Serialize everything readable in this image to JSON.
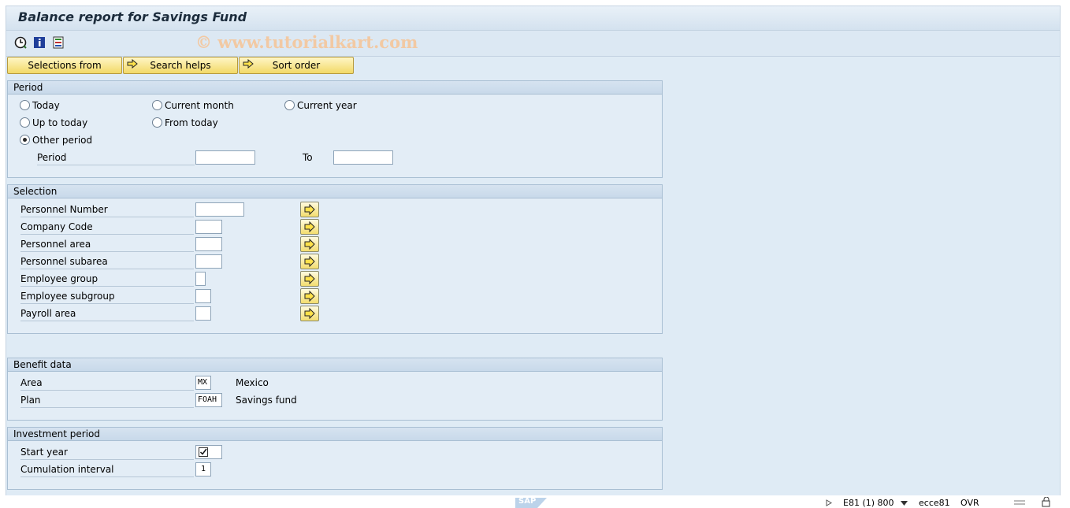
{
  "window": {
    "title": "Balance report for Savings Fund"
  },
  "watermark": "© www.tutorialkart.com",
  "toolbar": {
    "icons": [
      "execute-icon",
      "info-icon",
      "variants-icon"
    ]
  },
  "buttons": {
    "selections_from": "Selections from",
    "search_helps": "Search helps",
    "sort_order": "Sort order"
  },
  "period": {
    "title": "Period",
    "options": {
      "today": "Today",
      "current_month": "Current month",
      "current_year": "Current year",
      "up_to_today": "Up to today",
      "from_today": "From today",
      "other_period": "Other period"
    },
    "selected": "other_period",
    "period_label": "Period",
    "from_value": "",
    "to_label": "To",
    "to_value": ""
  },
  "selection": {
    "title": "Selection",
    "fields": [
      {
        "label": "Personnel Number",
        "value": ""
      },
      {
        "label": "Company Code",
        "value": ""
      },
      {
        "label": "Personnel area",
        "value": ""
      },
      {
        "label": "Personnel subarea",
        "value": ""
      },
      {
        "label": "Employee group",
        "value": ""
      },
      {
        "label": "Employee subgroup",
        "value": ""
      },
      {
        "label": "Payroll area",
        "value": ""
      }
    ]
  },
  "benefit": {
    "title": "Benefit data",
    "area_label": "Area",
    "area_value": "MX",
    "area_desc": "Mexico",
    "plan_label": "Plan",
    "plan_value": "FOAH",
    "plan_desc": "Savings fund"
  },
  "investment": {
    "title": "Investment period",
    "start_year_label": "Start year",
    "start_year_checked": true,
    "cumulation_label": "Cumulation interval",
    "cumulation_value": "1"
  },
  "statusbar": {
    "system": "E81 (1) 800",
    "server": "ecce81",
    "mode": "OVR",
    "logo": "SAP"
  },
  "colors": {
    "button": "#f2d967",
    "frame": "#dfebf5",
    "group_header": "#c8d9ea"
  }
}
